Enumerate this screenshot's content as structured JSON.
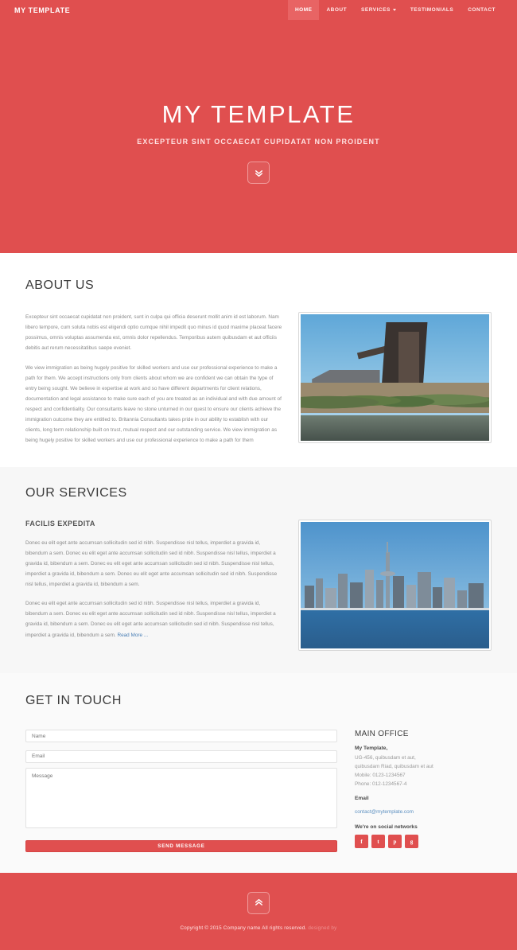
{
  "nav": {
    "brand": "MY TEMPLATE",
    "items": [
      {
        "label": "HOME",
        "active": true,
        "caret": false
      },
      {
        "label": "ABOUT",
        "active": false,
        "caret": false
      },
      {
        "label": "SERVICES",
        "active": false,
        "caret": true
      },
      {
        "label": "TESTIMONIALS",
        "active": false,
        "caret": false
      },
      {
        "label": "CONTACT",
        "active": false,
        "caret": false
      }
    ]
  },
  "hero": {
    "title": "MY TEMPLATE",
    "subtitle": "EXCEPTEUR SINT OCCAECAT CUPIDATAT NON PROIDENT",
    "scroll_icon": "chevron-double-down-icon"
  },
  "about": {
    "title": "ABOUT US",
    "paragraph1": "Excepteur sint occaecat cupidatat non proident, sunt in culpa qui officia deserunt mollit anim id est laborum. Nam libero tempore, cum soluta nobis est eligendi optio cumque nihil impedit quo minus id quod maxime placeat facere possimus, omnis voluptas assumenda est, omnis dolor repellendus. Temporibus autem quibusdam et aut officiis debitis aut rerum necessitatibus saepe eveniet.",
    "paragraph2": "We view immigration as being hugely positive for skilled workers and use our professional experience to make a path for them. We accept instructions only from clients about whom we are confident we can obtain the type of entry being sought. We believe in expertise at work and so have different departments for client relations, documentation and legal assistance to make sure each of you are treated as an individual and with due amount of respect and confidentiality. Our consultants leave no stone unturned in our quest to ensure our clients achieve the immigration outcome they are entitled to. Britannia Consultants takes pride in our ability to establish with our clients, long term relationship built on trust, mutual respect and our outstanding service. We view immigration as being hugely positive for skilled workers and use our professional experience to make a path for them",
    "image_alt": "industrial-blast-furnace-photo"
  },
  "services": {
    "title": "OUR SERVICES",
    "item_title": "FACILIS EXPEDITA",
    "paragraph1": "Donec eu elit eget ante accumsan sollicitudin sed id nibh. Suspendisse nisl tellus, imperdiet a gravida id, bibendum a sem. Donec eu elit eget ante accumsan sollicitudin sed id nibh. Suspendisse nisl tellus, imperdiet a gravida id, bibendum a sem. Donec eu elit eget ante accumsan sollicitudin sed id nibh. Suspendisse nisl tellus, imperdiet a gravida id, bibendum a sem. Donec eu elit eget ante accumsan sollicitudin sed id nibh. Suspendisse nisl tellus, imperdiet a gravida id, bibendum a sem.",
    "paragraph2": "Donec eu elit eget ante accumsan sollicitudin sed id nibh. Suspendisse nisl tellus, imperdiet a gravida id, bibendum a sem. Donec eu elit eget ante accumsan sollicitudin sed id nibh. Suspendisse nisl tellus, imperdiet a gravida id, bibendum a sem. Donec eu elit eget ante accumsan sollicitudin sed id nibh. Suspendisse nisl tellus, imperdiet a gravida id, bibendum a sem. ",
    "read_more": "Read More ...",
    "image_alt": "city-skyline-waterfront-photo"
  },
  "contact": {
    "title": "GET IN TOUCH",
    "name_placeholder": "Name",
    "name_value": "",
    "email_placeholder": "Email",
    "email_value": "",
    "message_placeholder": "Message",
    "message_value": "",
    "submit_label": "SEND MESSAGE"
  },
  "office": {
    "title": "MAIN OFFICE",
    "company": "My Template,",
    "address_line1": "UG-456, quibusdam et aut,",
    "address_line2": "quibusdam Riad, quibusdam et aut",
    "mobile": "Mobile: 0123-1234567",
    "phone": "Phone: 012-1234567-4",
    "email_label": "Email",
    "email": "contact@mytemplate.com",
    "social_label": "We're on social networks",
    "socials": [
      {
        "name": "facebook-icon",
        "glyph": "f"
      },
      {
        "name": "twitter-icon",
        "glyph": "t"
      },
      {
        "name": "pinterest-icon",
        "glyph": "p"
      },
      {
        "name": "google-plus-icon",
        "glyph": "g"
      }
    ]
  },
  "footer": {
    "top_icon": "chevron-double-up-icon",
    "copyright": "Copyright © 2015 Company name All rights reserved.",
    "credit_link": "designed by"
  },
  "colors": {
    "brand_red": "#e04f4f",
    "link_blue": "#4a7fb5",
    "section_gray": "#f7f7f7"
  }
}
